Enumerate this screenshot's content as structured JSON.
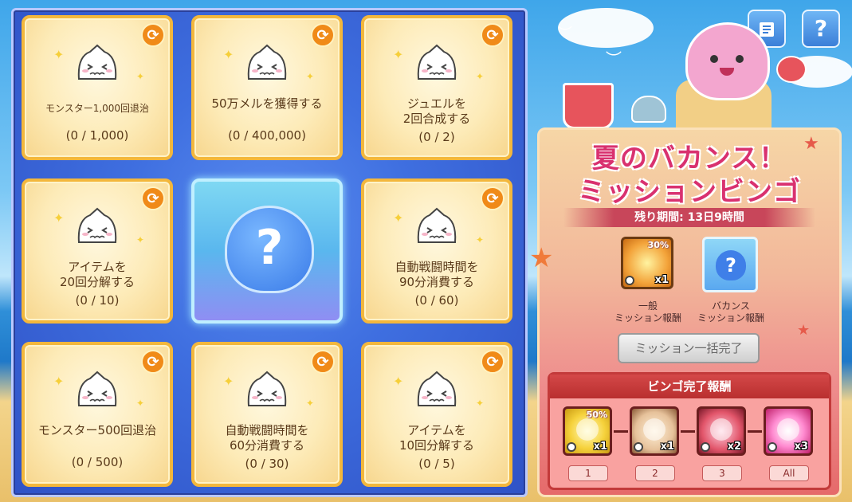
{
  "board": {
    "cells": [
      {
        "title": "モンスター1,000回退治",
        "progress": "(0 / 1,000)",
        "small": true
      },
      {
        "title": "50万メルを獲得する",
        "progress": "(0 / 400,000)",
        "small": false
      },
      {
        "title": "ジュエルを\n2回合成する",
        "progress": "(0 / 2)",
        "small": false
      },
      {
        "title": "アイテムを\n20回分解する",
        "progress": "(0 / 10)",
        "small": false
      },
      {
        "title": "",
        "progress": "",
        "mystery": true
      },
      {
        "title": "自動戦闘時間を\n90分消費する",
        "progress": "(0 / 60)",
        "small": false
      },
      {
        "title": "モンスター500回退治",
        "progress": "(0 / 500)",
        "small": false
      },
      {
        "title": "自動戦闘時間を\n60分消費する",
        "progress": "(0 / 30)",
        "small": false
      },
      {
        "title": "アイテムを\n10回分解する",
        "progress": "(0 / 5)",
        "small": false
      }
    ],
    "center_symbol": "?"
  },
  "topbar": {
    "log_icon": "scroll-icon",
    "help_label": "?"
  },
  "panel": {
    "title_line1": "夏のバカンス！",
    "title_line2": "ミッションビンゴ",
    "period": "残り期間: 13日9時間",
    "general_reward": {
      "percent": "30%",
      "qty": "x1",
      "label": "一般\nミッション報酬"
    },
    "vacance_reward": {
      "symbol": "?",
      "label": "バカンス\nミッション報酬"
    },
    "complete_all_button": "ミッション一括完了",
    "bingo_header": "ビンゴ完了報酬",
    "bingo_rewards": [
      {
        "number": "1",
        "qty": "x1",
        "percent": "50%",
        "icon": "exp-boost-icon"
      },
      {
        "number": "2",
        "qty": "x1",
        "percent": "",
        "icon": "jar-icon"
      },
      {
        "number": "3",
        "qty": "x2",
        "percent": "",
        "icon": "red-crystal-icon"
      },
      {
        "number": "All",
        "qty": "x3",
        "percent": "",
        "icon": "pink-burst-icon"
      }
    ]
  },
  "colors": {
    "title_pink": "#d9316f",
    "cell_border": "#f3b73c",
    "refresh_orange": "#f08a18",
    "bingo_red": "#c33a3a"
  }
}
